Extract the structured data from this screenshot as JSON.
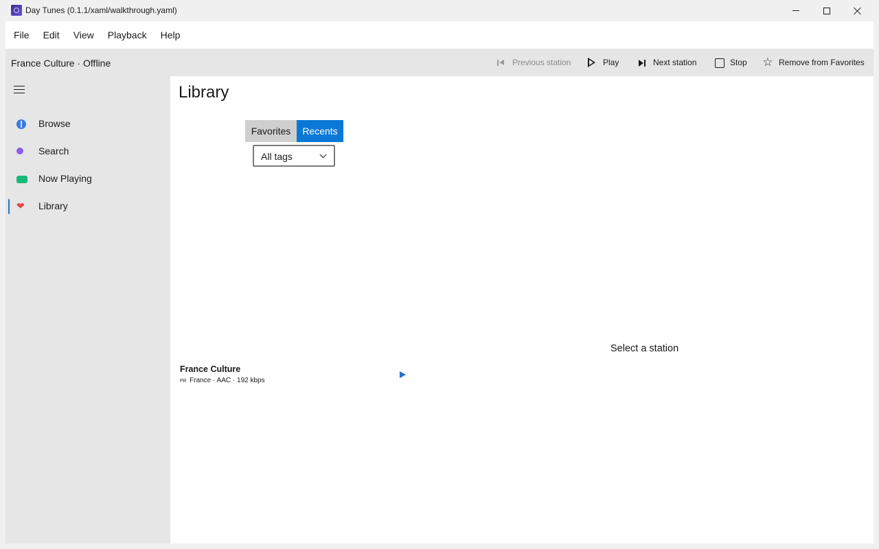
{
  "window": {
    "title": "Day Tunes (0.1.1/xaml/walkthrough.yaml)"
  },
  "menu": {
    "items": [
      "File",
      "Edit",
      "View",
      "Playback",
      "Help"
    ]
  },
  "toolbar": {
    "status": "France Culture · Offline",
    "previous_label": "Previous station",
    "play_label": "Play",
    "next_label": "Next station",
    "stop_label": "Stop",
    "favorite_label": "Remove from Favorites"
  },
  "sidebar": {
    "items": [
      {
        "label": "Browse",
        "icon": "compass-icon",
        "color": "#3a7be6"
      },
      {
        "label": "Search",
        "icon": "search-icon",
        "color": "#8e5ce8"
      },
      {
        "label": "Now Playing",
        "icon": "now-playing-icon",
        "color": "#18b87a"
      },
      {
        "label": "Library",
        "icon": "heart-icon",
        "color": "#e84545",
        "active": true
      }
    ]
  },
  "main": {
    "title": "Library",
    "tabs": [
      {
        "label": "Favorites",
        "selected": false
      },
      {
        "label": "Recents",
        "selected": true
      }
    ],
    "tag_filter": {
      "selected": "All tags"
    },
    "stations": [
      {
        "name": "France Culture",
        "country_code": "FR",
        "meta": "France · AAC · 192 kbps"
      }
    ],
    "detail_placeholder": "Select a station"
  },
  "colors": {
    "accent": "#0a78d4",
    "sidebar_bg": "#e6e6e6",
    "content_bg": "#ffffff"
  }
}
